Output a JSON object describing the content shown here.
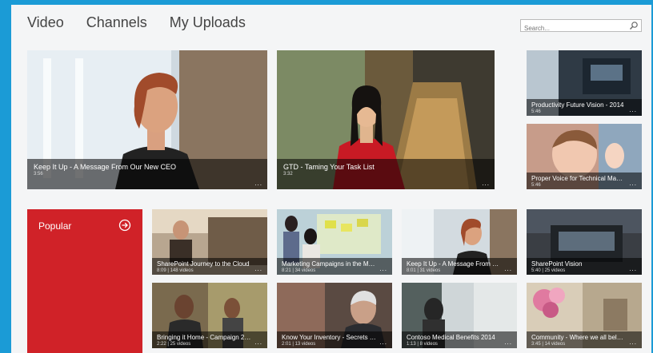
{
  "nav": {
    "tabs": [
      "Video",
      "Channels",
      "My Uploads"
    ]
  },
  "search": {
    "placeholder": "Search..."
  },
  "featured": [
    {
      "title": "Keep It Up - A Message From Our New CEO",
      "meta": "3:56"
    },
    {
      "title": "GTD - Taming Your Task List",
      "meta": "3:32"
    },
    {
      "title": "Productivity Future Vision - 2014",
      "meta": "5:46"
    },
    {
      "title": "Proper Voice for Technical Manuals",
      "meta": "5:46"
    }
  ],
  "popular": {
    "label": "Popular"
  },
  "channels": [
    {
      "title": "SharePoint Journey to the Cloud",
      "meta": "8:09 | 148 videos"
    },
    {
      "title": "Marketing Campaigns in the Modern...",
      "meta": "8:21 | 34 videos"
    },
    {
      "title": "Keep It Up - A Message From Our Ne...",
      "meta": "8:01 | 31 videos"
    },
    {
      "title": "SharePoint Vision",
      "meta": "5:40 | 25 videos"
    },
    {
      "title": "Bringing it Home - Campaign 2014",
      "meta": "2:22 | 25 videos"
    },
    {
      "title": "Know Your Inventory - Secrets To Sell...",
      "meta": "2:01 | 13 videos"
    },
    {
      "title": "Contoso Medical Benefits 2014",
      "meta": "1:13 | 8 videos"
    },
    {
      "title": "Community - Where we all belong",
      "meta": "3:45 | 14 videos"
    }
  ],
  "more_glyph": "...",
  "colors": {
    "frame": "#1b9bd6",
    "popular": "#d02228",
    "page": "#f4f5f6"
  }
}
